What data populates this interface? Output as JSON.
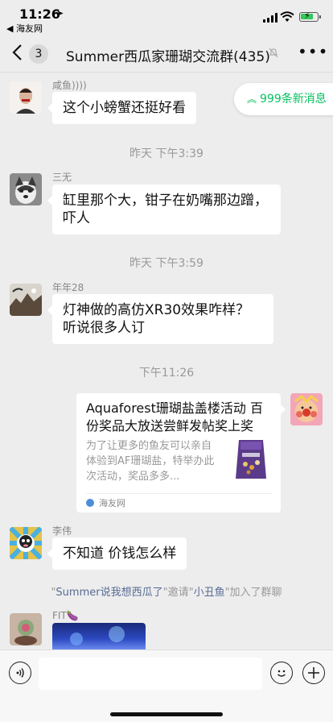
{
  "status_bar": {
    "time": "11:26",
    "back_app": "◀ 海友网"
  },
  "header": {
    "back_icon": "chevron-left-icon",
    "unread_count": "3",
    "title": "Summer西瓜家珊瑚交流群(435)"
  },
  "new_messages": {
    "label": "999条新消息"
  },
  "messages": [
    {
      "sender": "咸鱼))))",
      "text": "这个小螃蟹还挺好看"
    },
    {
      "sender": "三无",
      "text": "缸里那个大，钳子在奶嘴那边蹭，吓人"
    },
    {
      "sender": "年年28",
      "text": "灯神做的高仿XR30效果咋样？听说很多人订"
    },
    {
      "sender": "李伟",
      "text": "不知道 价钱怎么样"
    },
    {
      "sender": "FIT🍆",
      "text": ""
    }
  ],
  "timestamps": [
    "昨天 下午3:39",
    "昨天 下午3:59",
    "下午11:26"
  ],
  "link_card": {
    "title": "Aquaforest珊瑚盐盖楼活动 百份奖品大放送尝鲜发帖奖上奖",
    "description": "为了让更多的鱼友可以亲自体验到AF珊瑚盐，特举办此次活动，奖品多多...",
    "source": "海友网"
  },
  "system_message": {
    "prefix": "\"",
    "actor": "Summer说我想西瓜了",
    "middle": "\"邀请\"",
    "invitee": "小丑鱼",
    "suffix": "\"加入了群聊"
  },
  "colors": {
    "accent_green": "#07c160",
    "link_blue": "#576b95",
    "background": "#ededed"
  }
}
